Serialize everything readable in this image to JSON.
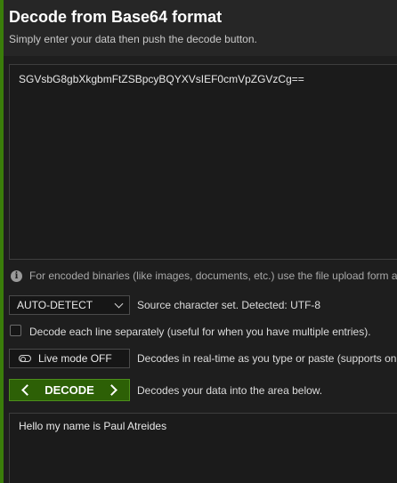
{
  "header": {
    "title": "Decode from Base64 format",
    "subtitle": "Simply enter your data then push the decode button."
  },
  "input": {
    "value": "SGVsbG8gbXkgbmFtZSBpcyBQYXVsIEF0cmVpZGVzCg=="
  },
  "note": {
    "icon": "info-icon",
    "text": "For encoded binaries (like images, documents, etc.) use the file upload form a"
  },
  "charset": {
    "selected": "AUTO-DETECT",
    "description": "Source character set. Detected: UTF-8"
  },
  "each_line": {
    "checked": false,
    "label": "Decode each line separately (useful for when you have multiple entries)."
  },
  "live_mode": {
    "label": "Live mode OFF",
    "description": "Decodes in real-time as you type or paste (supports on"
  },
  "decode": {
    "label": "DECODE",
    "description": "Decodes your data into the area below."
  },
  "output": {
    "value": "Hello my name is Paul Atreides"
  },
  "colors": {
    "accent_green": "#2d6006",
    "outer_green": "#3a7d0a",
    "background": "#1e1e1e",
    "header_bg": "#262626"
  }
}
